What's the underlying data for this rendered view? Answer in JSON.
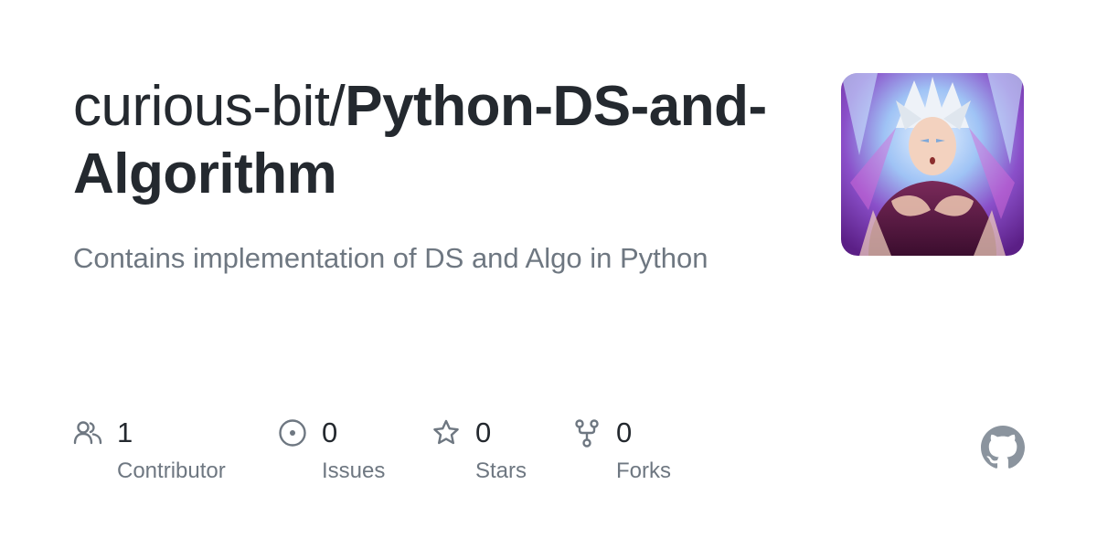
{
  "repo": {
    "owner": "curious-bit/",
    "name": "Python-DS-and-Algorithm",
    "description": "Contains implementation of DS and Algo in Python"
  },
  "stats": [
    {
      "icon": "people-icon",
      "count": "1",
      "label": "Contributor"
    },
    {
      "icon": "issue-opened-icon",
      "count": "0",
      "label": "Issues"
    },
    {
      "icon": "star-icon",
      "count": "0",
      "label": "Stars"
    },
    {
      "icon": "repo-forked-icon",
      "count": "0",
      "label": "Forks"
    }
  ],
  "brand_icon": "github-mark-icon",
  "colors": {
    "text": "#24292f",
    "muted": "#6e7781",
    "icon": "#6e7781",
    "brand": "#8b949e"
  }
}
